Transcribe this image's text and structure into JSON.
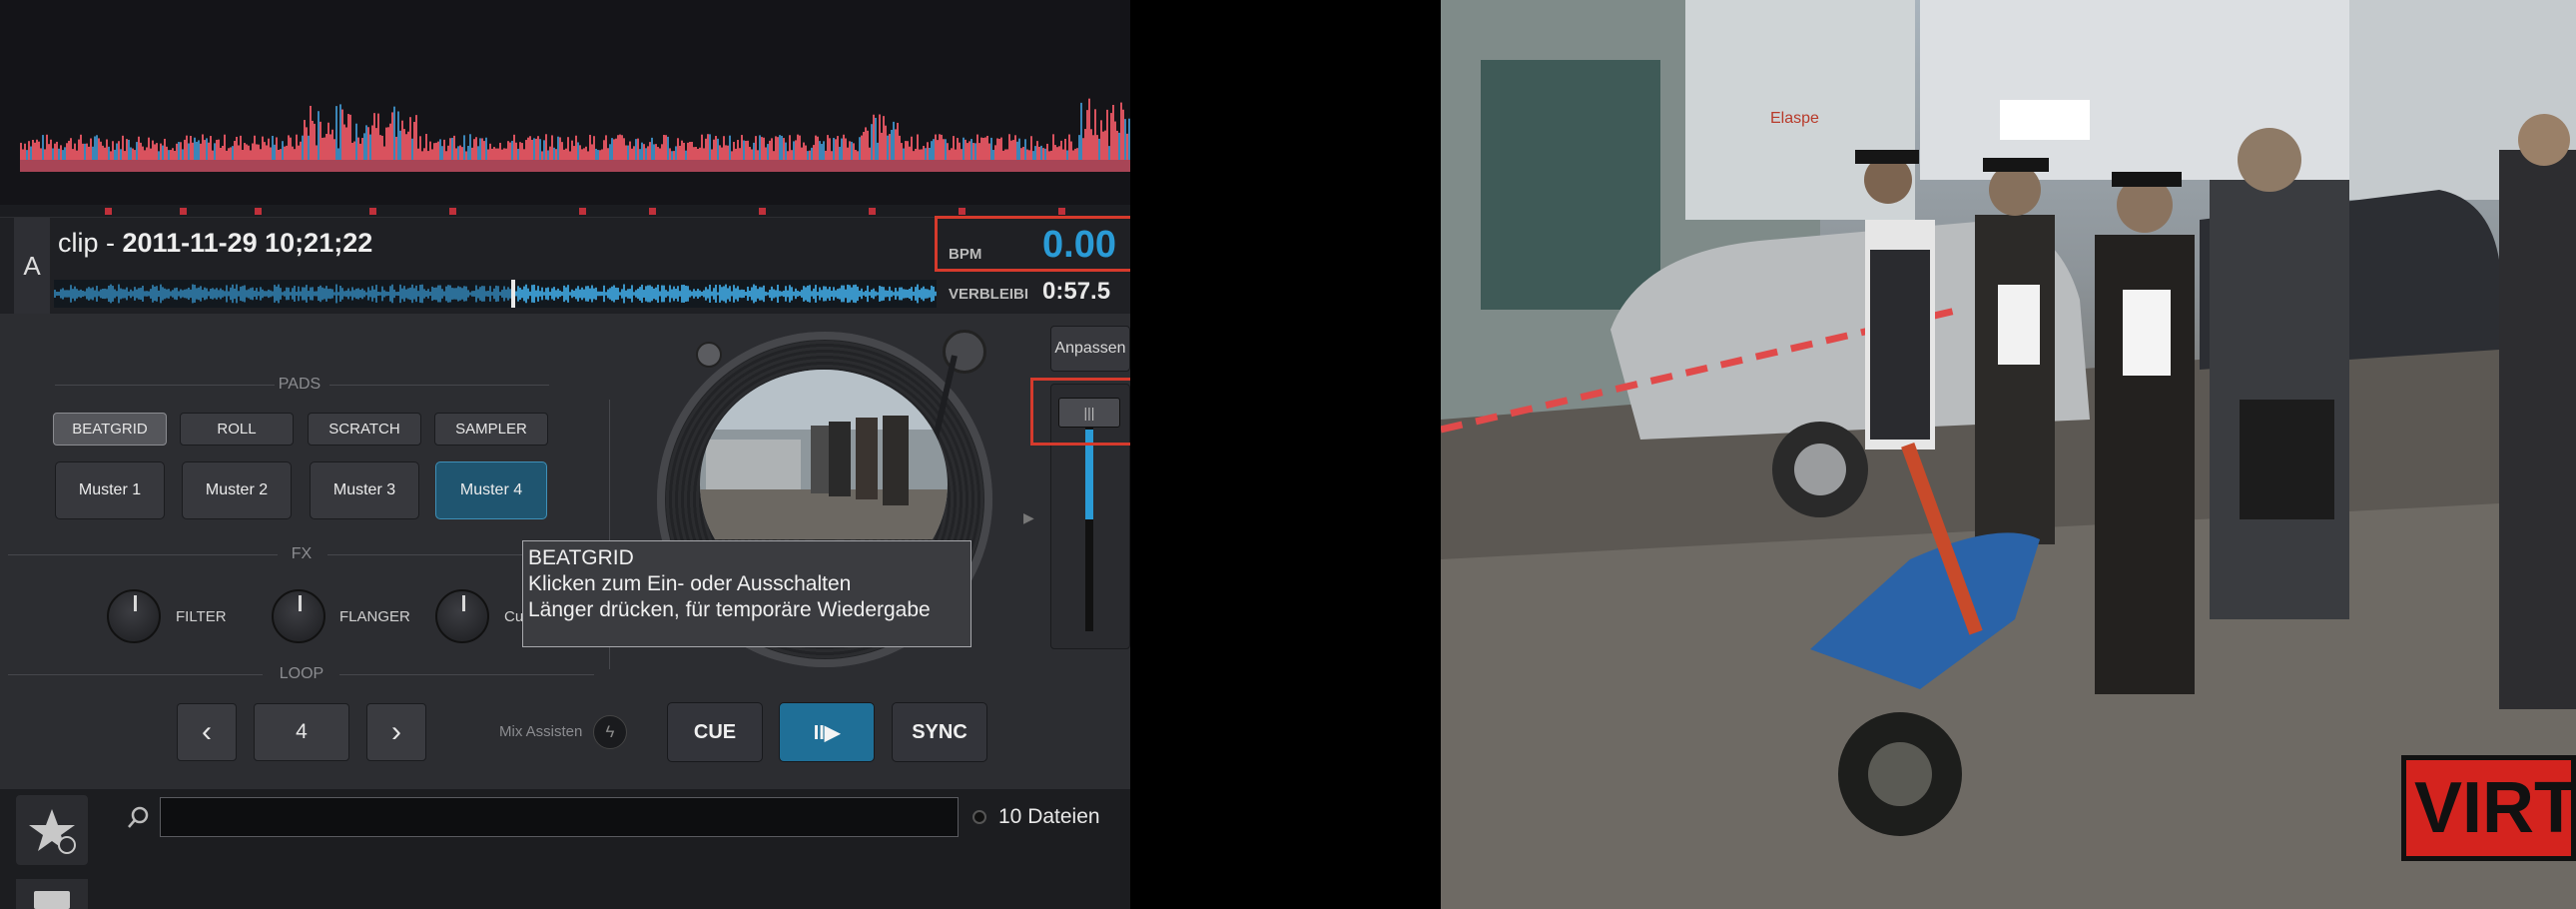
{
  "deck": {
    "letter": "A",
    "track_prefix": "clip - ",
    "track_title": "2011-11-29 10;21;22",
    "bpm_label": "BPM",
    "bpm_value": "0.00",
    "remaining_label": "VERBLEIBI",
    "remaining_value": "0:57.5"
  },
  "pads": {
    "title": "PADS",
    "modes": [
      "BEATGRID",
      "ROLL",
      "SCRATCH",
      "SAMPLER"
    ],
    "selected_mode": "BEATGRID",
    "patterns": [
      "Muster 1",
      "Muster 2",
      "Muster 3",
      "Muster 4"
    ],
    "active_pattern": "Muster 4"
  },
  "fx": {
    "title": "FX",
    "knobs": [
      "FILTER",
      "FLANGER",
      "Cu"
    ]
  },
  "loop": {
    "title": "LOOP",
    "prev": "‹",
    "size": "4",
    "next": "›"
  },
  "mix_assist_label": "Mix Assisten",
  "transport": {
    "cue": "CUE",
    "play": "II▶",
    "sync": "SYNC"
  },
  "pitch": {
    "adjust_label": "Anpassen",
    "handle_glyph": "|||",
    "level": 0.5
  },
  "tooltip": {
    "title": "BEATGRID",
    "line1": "Klicken zum Ein- oder Ausschalten",
    "line2": "Länger drücken, für temporäre Wiedergabe"
  },
  "library": {
    "file_count": "10 Dateien",
    "search_value": ""
  },
  "video": {
    "watermark": "VIRT",
    "shop_sign": "Elaspe"
  },
  "colors": {
    "accent_blue": "#2a9bd6",
    "highlight_red": "#d63a2c",
    "waveform_red": "#d9525e"
  },
  "icons": {
    "favorites": "star-icon",
    "search": "search-icon",
    "mix_assist": "lightning-icon"
  }
}
